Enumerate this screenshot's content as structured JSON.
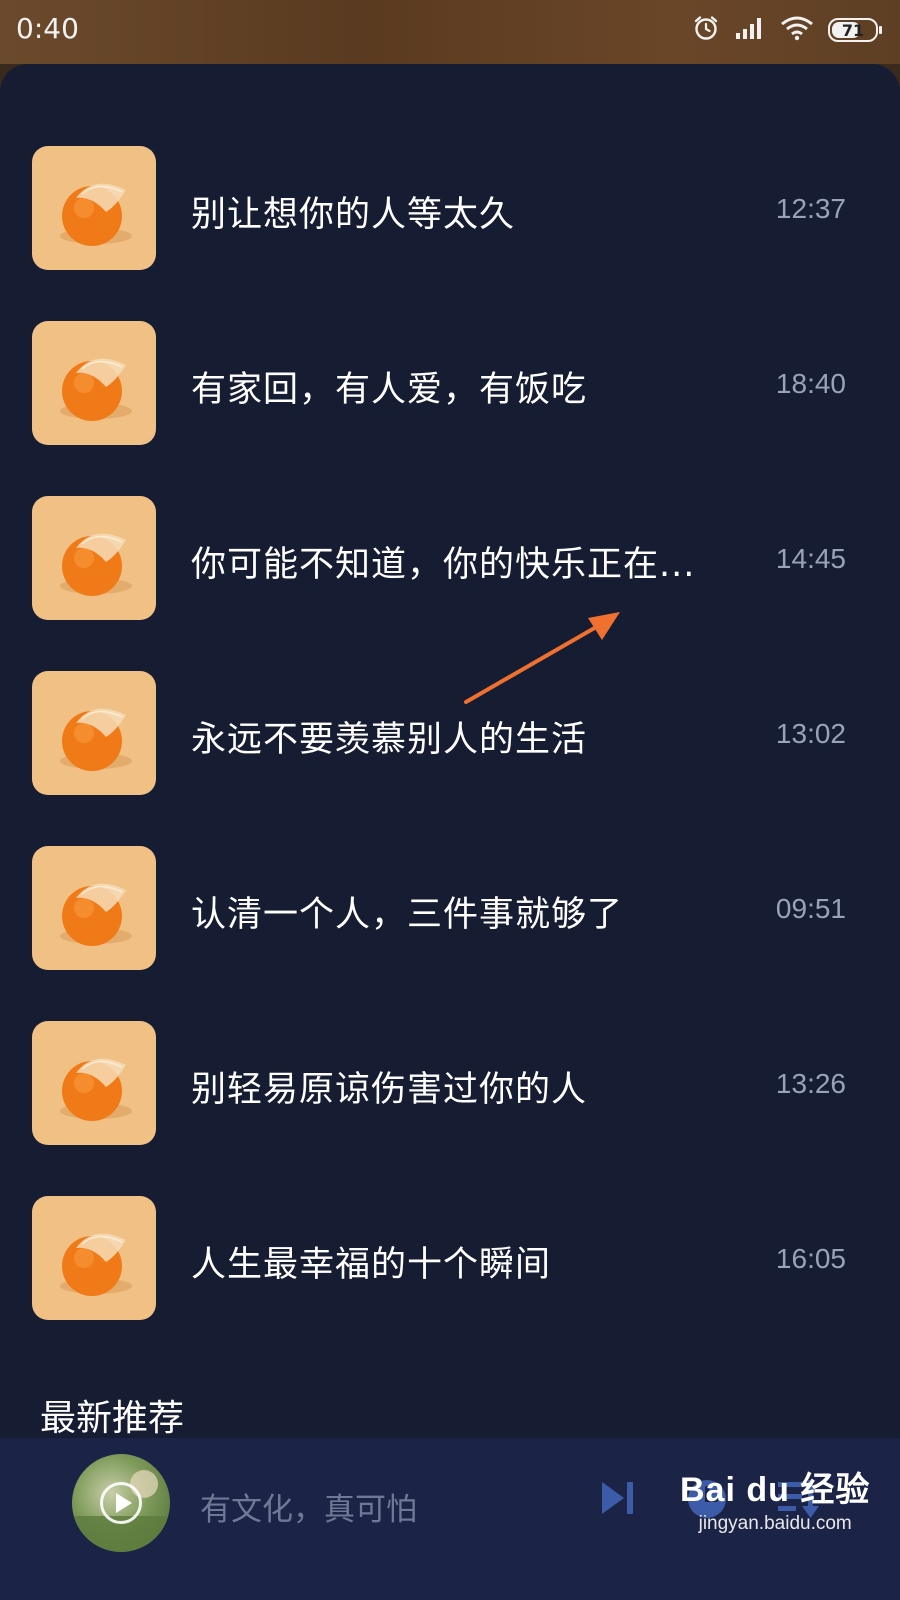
{
  "status_bar": {
    "time": "0:40",
    "battery": "71",
    "battery_level": 0.71,
    "icons": [
      "alarm-icon",
      "signal-icon",
      "wifi-icon",
      "battery-icon"
    ]
  },
  "articles": [
    {
      "title": "别让想你的人等太久",
      "time": "12:37"
    },
    {
      "title": "有家回，有人爱，有饭吃",
      "time": "18:40"
    },
    {
      "title": "你可能不知道，你的快乐正在...",
      "time": "14:45"
    },
    {
      "title": "永远不要羡慕别人的生活",
      "time": "13:02"
    },
    {
      "title": "认清一个人，三件事就够了",
      "time": "09:51"
    },
    {
      "title": "别轻易原谅伤害过你的人",
      "time": "13:26"
    },
    {
      "title": "人生最幸福的十个瞬间",
      "time": "16:05"
    }
  ],
  "section": {
    "title": "最新推荐"
  },
  "player": {
    "now_playing": "有文化，真可怕",
    "icons": [
      "play-icon",
      "next-icon",
      "timer-icon",
      "playlist-icon"
    ]
  },
  "watermark": {
    "logo": "Bai du 经验",
    "url": "jingyan.baidu.com"
  },
  "colors": {
    "sheet_bg": "#161d33",
    "player_bg": "#1b2447",
    "thumb_bg": "#f0c084",
    "arrow": "#f07030",
    "time_text": "#9aa2b8"
  }
}
